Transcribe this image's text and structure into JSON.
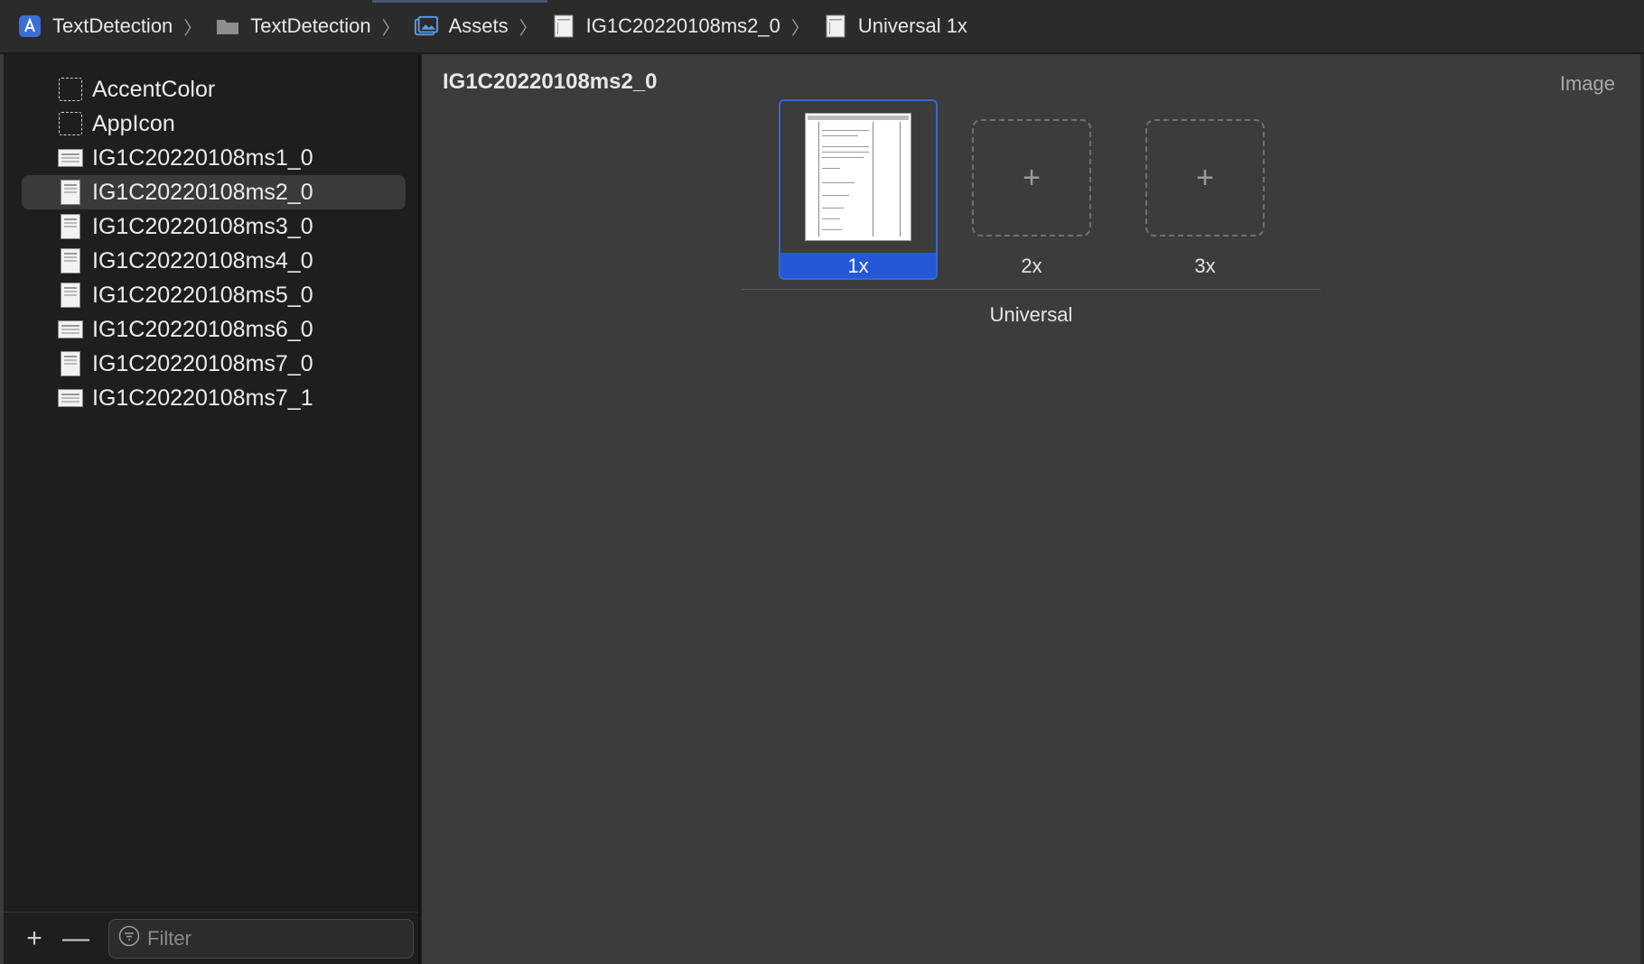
{
  "breadcrumb": {
    "items": [
      {
        "label": "TextDetection",
        "icon": "xcode-project-icon"
      },
      {
        "label": "TextDetection",
        "icon": "folder-icon"
      },
      {
        "label": "Assets",
        "icon": "asset-catalog-icon"
      },
      {
        "label": "IG1C20220108ms2_0",
        "icon": "image-set-icon"
      },
      {
        "label": "Universal 1x",
        "icon": "image-file-icon"
      }
    ]
  },
  "sidebar": {
    "items": [
      {
        "label": "AccentColor",
        "kind": "color-set"
      },
      {
        "label": "AppIcon",
        "kind": "app-icon-set"
      },
      {
        "label": "IG1C20220108ms1_0",
        "kind": "landscape"
      },
      {
        "label": "IG1C20220108ms2_0",
        "kind": "portrait",
        "selected": true
      },
      {
        "label": "IG1C20220108ms3_0",
        "kind": "portrait"
      },
      {
        "label": "IG1C20220108ms4_0",
        "kind": "portrait"
      },
      {
        "label": "IG1C20220108ms5_0",
        "kind": "portrait"
      },
      {
        "label": "IG1C20220108ms6_0",
        "kind": "landscape"
      },
      {
        "label": "IG1C20220108ms7_0",
        "kind": "portrait"
      },
      {
        "label": "IG1C20220108ms7_1",
        "kind": "landscape"
      }
    ],
    "footer": {
      "add_label": "+",
      "remove_label": "—",
      "filter_placeholder": "Filter"
    }
  },
  "editor": {
    "title": "IG1C20220108ms2_0",
    "type_label": "Image",
    "slots": {
      "one_x": "1x",
      "two_x": "2x",
      "three_x": "3x",
      "add_symbol": "+"
    },
    "group_label": "Universal"
  },
  "colors": {
    "selection_blue": "#2558d6",
    "editor_bg": "#3c3c3c",
    "sidebar_bg": "#1e1e1e"
  }
}
